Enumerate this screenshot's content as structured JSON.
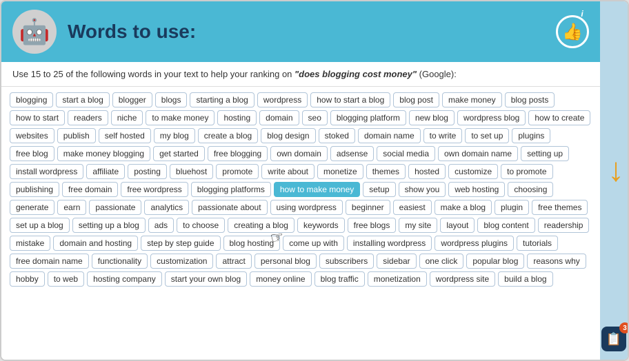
{
  "header": {
    "title": "Words to use:",
    "thumbs_up_icon": "👍",
    "info_icon": "i",
    "robot_icon": "🤖"
  },
  "subtitle": {
    "text_before": "Use 15 to 25 of the following words in your text to help your ranking on ",
    "keyword": "\"does blogging cost money\"",
    "text_after": " (Google):"
  },
  "words": [
    "blogging",
    "start a blog",
    "blogger",
    "blogs",
    "starting a blog",
    "wordpress",
    "how to start a blog",
    "blog post",
    "make money",
    "blog posts",
    "how to start",
    "readers",
    "niche",
    "to make money",
    "hosting",
    "domain",
    "seo",
    "blogging platform",
    "new blog",
    "wordpress blog",
    "how to create",
    "websites",
    "publish",
    "self hosted",
    "my blog",
    "create a blog",
    "blog design",
    "stoked",
    "domain name",
    "to write",
    "to set up",
    "plugins",
    "free blog",
    "make money blogging",
    "get started",
    "free blogging",
    "own domain",
    "adsense",
    "social media",
    "own domain name",
    "setting up",
    "install wordpress",
    "affiliate",
    "posting",
    "bluehost",
    "promote",
    "write about",
    "monetize",
    "themes",
    "hosted",
    "customize",
    "to promote",
    "publishing",
    "free domain",
    "free wordpress",
    "blogging platforms",
    "how to make money",
    "setup",
    "show you",
    "web hosting",
    "choosing",
    "generate",
    "earn",
    "passionate",
    "analytics",
    "passionate about",
    "using wordpress",
    "beginner",
    "easiest",
    "make a blog",
    "plugin",
    "free themes",
    "set up a blog",
    "setting up a blog",
    "ads",
    "to choose",
    "creating a blog",
    "keywords",
    "free blogs",
    "my site",
    "layout",
    "blog content",
    "readership",
    "mistake",
    "domain and hosting",
    "step by step guide",
    "blog hosting",
    "come up with",
    "installing wordpress",
    "wordpress plugins",
    "tutorials",
    "free domain name",
    "functionality",
    "customization",
    "attract",
    "personal blog",
    "subscribers",
    "sidebar",
    "one click",
    "popular blog",
    "reasons why",
    "hobby",
    "to web",
    "hosting company",
    "start your own blog",
    "money online",
    "blog traffic",
    "monetization",
    "wordpress site",
    "build a blog"
  ],
  "highlighted_word": "how to make money",
  "sidebar": {
    "arrow_label": "▼",
    "add_icon": "⊕",
    "badge_count": "3"
  }
}
